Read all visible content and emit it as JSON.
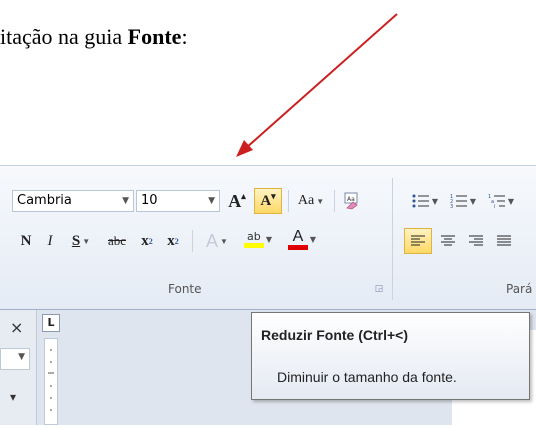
{
  "caption": {
    "prefix": "itação na guia ",
    "bold": "Fonte",
    "suffix": ":"
  },
  "colors": {
    "arrow": "#cc1f1f",
    "highlight": "#ffd966",
    "text_highlight": "#ffff00",
    "font_color": "#e00000"
  },
  "font_group": {
    "font_name": "Cambria",
    "font_size": "10",
    "grow_font": "A",
    "shrink_font": "A",
    "change_case": "Aa",
    "bold": "N",
    "italic": "I",
    "underline": "S",
    "strikethrough": "abc",
    "subscript_base": "x",
    "subscript_mark": "2",
    "superscript_base": "x",
    "superscript_mark": "2",
    "text_effects": "A",
    "highlight_label": "ab",
    "font_color": "A",
    "label": "Fonte"
  },
  "paragraph_group": {
    "label": "Pará"
  },
  "tooltip": {
    "title": "Reduzir Fonte (Ctrl+<)",
    "description": "Diminuir o tamanho da fonte."
  },
  "ruler_button": "L",
  "close_glyph": "×"
}
